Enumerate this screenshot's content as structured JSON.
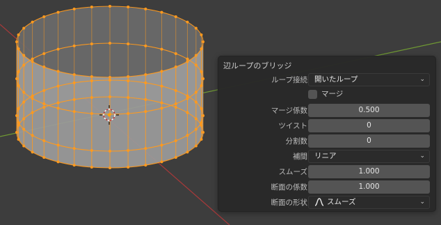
{
  "panel": {
    "title": "辺ループのブリッジ",
    "loop_connection": {
      "label": "ループ接続",
      "value": "開いたループ"
    },
    "merge": {
      "label": "マージ",
      "checked": false
    },
    "merge_factor": {
      "label": "マージ係数",
      "value": "0.500"
    },
    "twist": {
      "label": "ツイスト",
      "value": "0"
    },
    "cuts": {
      "label": "分割数",
      "value": "0"
    },
    "interpolation": {
      "label": "補間",
      "value": "リニア"
    },
    "smoothness": {
      "label": "スムーズ",
      "value": "1.000"
    },
    "profile_factor": {
      "label": "断面の係数",
      "value": "1.000"
    },
    "profile_shape": {
      "label": "断面の形状",
      "value": "スムーズ",
      "icon": "smooth-curve-icon"
    }
  },
  "icons": {
    "dropdown": "chevron-down-icon",
    "cursor": "3d-cursor-icon"
  },
  "colors": {
    "viewport_bg": "#3d3d3d",
    "selection_orange": "#ff9a1e",
    "mesh_face": "#9b9b9b",
    "panel_bg": "#282828",
    "field_bg": "#545454",
    "x_axis": "#a8393a",
    "y_axis": "#6f9933"
  }
}
